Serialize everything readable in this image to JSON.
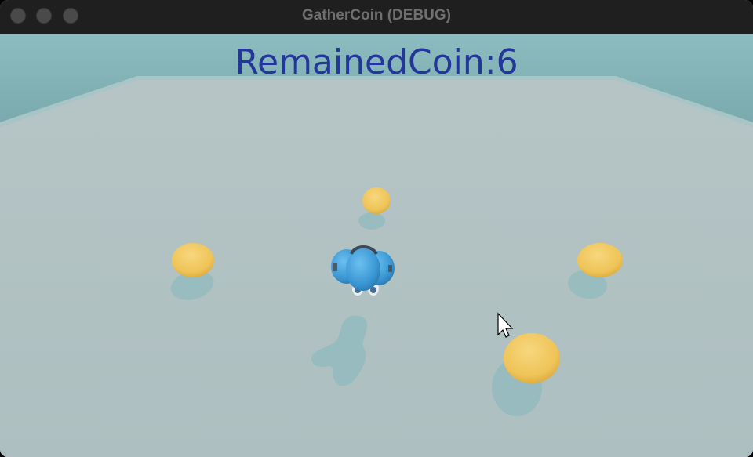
{
  "window": {
    "title": "GatherCoin (DEBUG)"
  },
  "hud": {
    "remained_coin": "RemainedCoin:6"
  },
  "scene": {
    "floor_color": "#b3c2c3",
    "wall_color": "#86b2b5",
    "coin_color": "#f0c65a",
    "player_color": "#3a9ad8"
  },
  "icons": {
    "cursor": "arrow-cursor-icon"
  }
}
